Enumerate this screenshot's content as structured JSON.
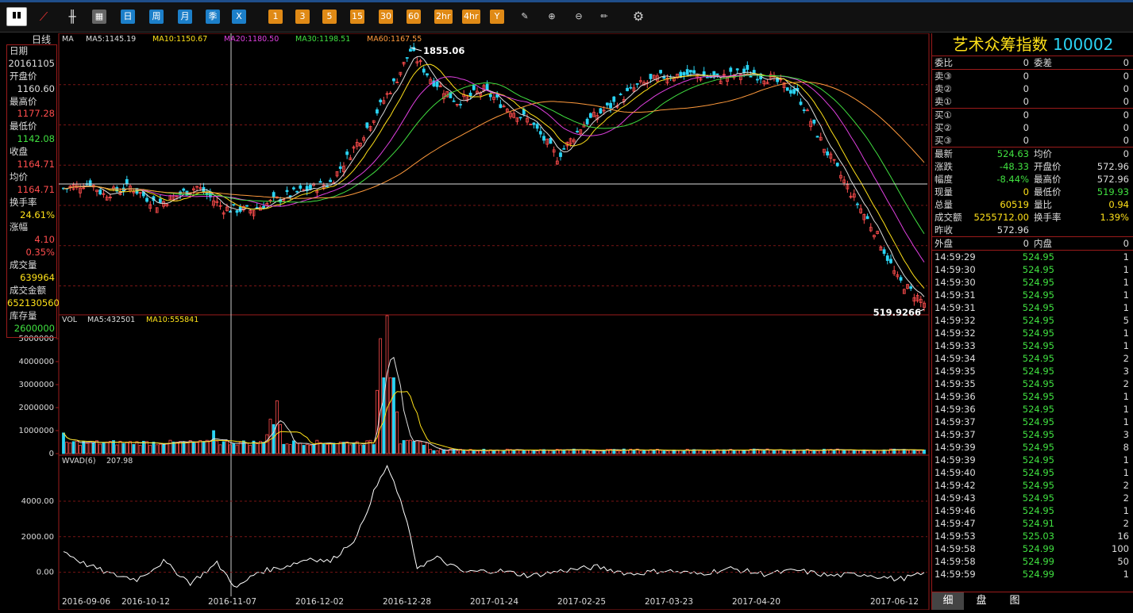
{
  "toolbar": {
    "buttons": [
      "日",
      "周",
      "月",
      "季",
      "X"
    ],
    "periods": [
      "1",
      "3",
      "5",
      "15",
      "30",
      "60",
      "2hr",
      "4hr",
      "Y"
    ]
  },
  "main_chart": {
    "period_label": "日线",
    "ma_legend": [
      {
        "label": "MA",
        "color": "#dddddd"
      },
      {
        "label": "MA5:1145.19",
        "color": "#dddddd"
      },
      {
        "label": "MA10:1150.67",
        "color": "#ffe119"
      },
      {
        "label": "MA20:1180.50",
        "color": "#e040e0"
      },
      {
        "label": "MA30:1198.51",
        "color": "#40e040"
      },
      {
        "label": "MA60:1167.55",
        "color": "#ff9a3c"
      }
    ],
    "high_label": "1855.06",
    "low_label": "519.9266"
  },
  "volume_chart": {
    "legend": [
      {
        "label": "VOL",
        "color": "#dddddd"
      },
      {
        "label": "MA5:432501",
        "color": "#dddddd"
      },
      {
        "label": "MA10:555841",
        "color": "#ffe119"
      }
    ],
    "y_ticks": [
      "5000000",
      "4000000",
      "3000000",
      "2000000",
      "1000000",
      "0"
    ]
  },
  "indicator_chart": {
    "legend": [
      {
        "label": "WVAD(6)",
        "color": "#dddddd"
      },
      {
        "label": "207.98",
        "color": "#dddddd"
      }
    ],
    "y_ticks": [
      "4000.00",
      "2000.00",
      "0.00"
    ]
  },
  "x_axis": [
    "2016-09-06",
    "2016-10-12",
    "2016-11-07",
    "2016-12-02",
    "2016-12-28",
    "2017-01-24",
    "2017-02-25",
    "2017-03-23",
    "2017-04-20",
    "2017-06-12"
  ],
  "left_panel": [
    {
      "label": "日期",
      "value": "20161105",
      "color": "#dddddd"
    },
    {
      "label": "开盘价",
      "value": "1160.60",
      "color": "#dddddd"
    },
    {
      "label": "最高价",
      "value": "1177.28",
      "color": "#ff4d4d"
    },
    {
      "label": "最低价",
      "value": "1142.08",
      "color": "#40e040"
    },
    {
      "label": "收盘",
      "value": "1164.71",
      "color": "#ff4d4d"
    },
    {
      "label": "均价",
      "value": "1164.71",
      "color": "#ff4d4d"
    },
    {
      "label": "换手率",
      "value": "24.61%",
      "color": "#ffe119"
    },
    {
      "label": "涨幅",
      "value": "4.10",
      "color": "#ff4d4d"
    },
    {
      "label": "",
      "value": "0.35%",
      "color": "#ff4d4d"
    },
    {
      "label": "成交量",
      "value": "639964",
      "color": "#ffe119"
    },
    {
      "label": "成交金额",
      "value": "652130560",
      "color": "#ffe119"
    },
    {
      "label": "库存量",
      "value": "2600000",
      "color": "#40e040"
    }
  ],
  "quote": {
    "name": "艺术众筹指数",
    "code": "100002",
    "wb": [
      {
        "l": "委比",
        "v": "0",
        "l2": "委差",
        "v2": "0"
      }
    ],
    "sell": [
      {
        "l": "卖③",
        "v": "0",
        "v2": "0"
      },
      {
        "l": "卖②",
        "v": "0",
        "v2": "0"
      },
      {
        "l": "卖①",
        "v": "0",
        "v2": "0"
      }
    ],
    "buy": [
      {
        "l": "买①",
        "v": "0",
        "v2": "0"
      },
      {
        "l": "买②",
        "v": "0",
        "v2": "0"
      },
      {
        "l": "买③",
        "v": "0",
        "v2": "0"
      }
    ],
    "stats": [
      {
        "l": "最新",
        "v": "524.63",
        "vc": "#40e040",
        "l2": "均价",
        "v2": "0",
        "v2c": "#dddddd"
      },
      {
        "l": "涨跌",
        "v": "-48.33",
        "vc": "#40e040",
        "l2": "开盘价",
        "v2": "572.96",
        "v2c": "#dddddd"
      },
      {
        "l": "幅度",
        "v": "-8.44%",
        "vc": "#40e040",
        "l2": "最高价",
        "v2": "572.96",
        "v2c": "#dddddd"
      },
      {
        "l": "现量",
        "v": "0",
        "vc": "#ffe119",
        "l2": "最低价",
        "v2": "519.93",
        "v2c": "#40e040"
      },
      {
        "l": "总量",
        "v": "60519",
        "vc": "#ffe119",
        "l2": "量比",
        "v2": "0.94",
        "v2c": "#ffe119"
      },
      {
        "l": "成交额",
        "v": "5255712.00",
        "vc": "#ffe119",
        "l2": "换手率",
        "v2": "1.39%",
        "v2c": "#ffe119"
      },
      {
        "l": "昨收",
        "v": "572.96",
        "vc": "#dddddd",
        "l2": "",
        "v2": "",
        "v2c": "#dddddd"
      }
    ],
    "outer_inner": {
      "l": "外盘",
      "v": "0",
      "l2": "内盘",
      "v2": "0"
    },
    "ticks": [
      [
        "14:59:29",
        "524.95",
        "1"
      ],
      [
        "14:59:30",
        "524.95",
        "1"
      ],
      [
        "14:59:30",
        "524.95",
        "1"
      ],
      [
        "14:59:31",
        "524.95",
        "1"
      ],
      [
        "14:59:31",
        "524.95",
        "1"
      ],
      [
        "14:59:32",
        "524.95",
        "5"
      ],
      [
        "14:59:32",
        "524.95",
        "1"
      ],
      [
        "14:59:33",
        "524.95",
        "1"
      ],
      [
        "14:59:34",
        "524.95",
        "2"
      ],
      [
        "14:59:35",
        "524.95",
        "3"
      ],
      [
        "14:59:35",
        "524.95",
        "2"
      ],
      [
        "14:59:36",
        "524.95",
        "1"
      ],
      [
        "14:59:36",
        "524.95",
        "1"
      ],
      [
        "14:59:37",
        "524.95",
        "1"
      ],
      [
        "14:59:37",
        "524.95",
        "3"
      ],
      [
        "14:59:39",
        "524.95",
        "8"
      ],
      [
        "14:59:39",
        "524.95",
        "1"
      ],
      [
        "14:59:40",
        "524.95",
        "1"
      ],
      [
        "14:59:42",
        "524.95",
        "2"
      ],
      [
        "14:59:43",
        "524.95",
        "2"
      ],
      [
        "14:59:46",
        "524.95",
        "1"
      ],
      [
        "14:59:47",
        "524.91",
        "2"
      ],
      [
        "14:59:53",
        "525.03",
        "16"
      ],
      [
        "14:59:58",
        "524.99",
        "100"
      ],
      [
        "14:59:58",
        "524.99",
        "50"
      ],
      [
        "14:59:59",
        "524.99",
        "1"
      ]
    ],
    "tabs": [
      "细",
      "盘",
      "图"
    ]
  },
  "chart_data": {
    "type": "candlestick",
    "x_range": [
      "2016-09-06",
      "2017-06-12"
    ],
    "price": {
      "ylim": [
        519.9266,
        1855.06
      ],
      "anchors": [
        [
          0,
          1140
        ],
        [
          8,
          1170
        ],
        [
          12,
          1110
        ],
        [
          20,
          1150
        ],
        [
          28,
          1060
        ],
        [
          40,
          1150
        ],
        [
          48,
          1040
        ],
        [
          56,
          1030
        ],
        [
          68,
          1110
        ],
        [
          80,
          1170
        ],
        [
          90,
          1420
        ],
        [
          100,
          1700
        ],
        [
          104,
          1840
        ],
        [
          110,
          1700
        ],
        [
          118,
          1580
        ],
        [
          126,
          1640
        ],
        [
          132,
          1560
        ],
        [
          140,
          1480
        ],
        [
          148,
          1300
        ],
        [
          156,
          1470
        ],
        [
          164,
          1560
        ],
        [
          172,
          1660
        ],
        [
          180,
          1710
        ],
        [
          188,
          1720
        ],
        [
          196,
          1700
        ],
        [
          204,
          1730
        ],
        [
          212,
          1700
        ],
        [
          220,
          1620
        ],
        [
          228,
          1350
        ],
        [
          236,
          1120
        ],
        [
          244,
          900
        ],
        [
          250,
          680
        ],
        [
          258,
          560
        ]
      ],
      "high_marker": 1855.06,
      "low_marker": 519.9266
    },
    "volume": {
      "ylim": [
        0,
        6000000
      ],
      "spikes": [
        {
          "i": 0,
          "v": 900000
        },
        {
          "i": 45,
          "v": 1000000
        },
        {
          "i": 62,
          "v": 1500000
        },
        {
          "i": 64,
          "v": 2300000
        },
        {
          "i": 95,
          "v": 5000000
        },
        {
          "i": 97,
          "v": 6000000
        },
        {
          "i": 99,
          "v": 3300000
        }
      ],
      "baseline": 450000
    },
    "wvad": {
      "ylim": [
        -1000,
        6500
      ],
      "anchors": [
        [
          0,
          1200
        ],
        [
          6,
          500
        ],
        [
          14,
          -100
        ],
        [
          22,
          -400
        ],
        [
          30,
          600
        ],
        [
          38,
          -600
        ],
        [
          46,
          500
        ],
        [
          52,
          -900
        ],
        [
          58,
          0
        ],
        [
          66,
          300
        ],
        [
          74,
          800
        ],
        [
          80,
          600
        ],
        [
          88,
          2000
        ],
        [
          93,
          4500
        ],
        [
          97,
          6000
        ],
        [
          102,
          3500
        ],
        [
          106,
          300
        ],
        [
          112,
          800
        ],
        [
          120,
          0
        ],
        [
          130,
          100
        ],
        [
          140,
          -200
        ],
        [
          150,
          100
        ],
        [
          160,
          300
        ],
        [
          170,
          -100
        ],
        [
          180,
          100
        ],
        [
          190,
          -100
        ],
        [
          200,
          200
        ],
        [
          210,
          -100
        ],
        [
          220,
          100
        ],
        [
          230,
          -200
        ],
        [
          240,
          -100
        ],
        [
          250,
          -400
        ],
        [
          258,
          -100
        ]
      ]
    }
  }
}
